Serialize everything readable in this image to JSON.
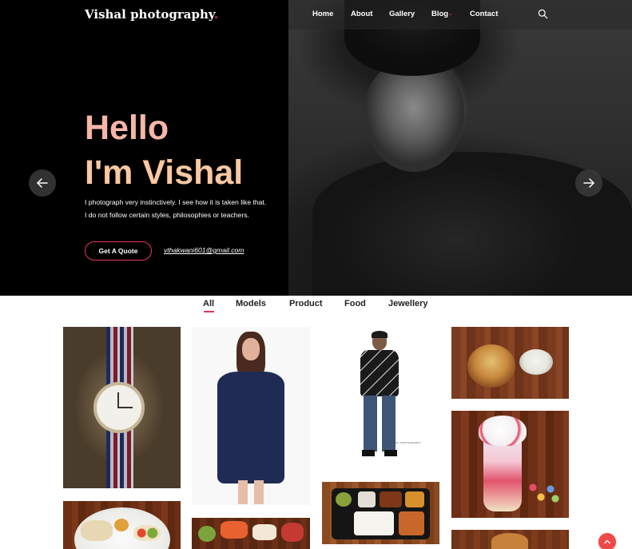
{
  "header": {
    "logo": "Vishal photography",
    "logo_dot": ".",
    "nav": {
      "home": "Home",
      "about": "About",
      "gallery": "Gallery",
      "blog": "Blog",
      "contact": "Contact"
    },
    "blog_caret": "⌄"
  },
  "hero": {
    "line1": "Hello",
    "line2": "I'm Vishal",
    "desc1": "I photograph very instinctively. I see how it is taken like that.",
    "desc2": "I do not follow certain styles, philosophies or teachers.",
    "quote_button": "Get A Quote",
    "email": "vthakwani601@gmail.com"
  },
  "filters": {
    "all": "All",
    "models": "Models",
    "product": "Product",
    "food": "Food",
    "jewellery": "Jewellery",
    "active": "All"
  },
  "gallery": {
    "male_model_caption": "VISHAL PHOTOGRAPHY"
  },
  "colors": {
    "accent": "#e8345a",
    "hero_text_1": "#f6b7a6",
    "hero_text_2": "#f9c8a1",
    "scroll_top": "#ef4a4a"
  },
  "icons": {
    "search": "search-icon",
    "prev": "arrow-left-icon",
    "next": "arrow-right-icon",
    "scroll_top": "chevron-up-icon"
  }
}
